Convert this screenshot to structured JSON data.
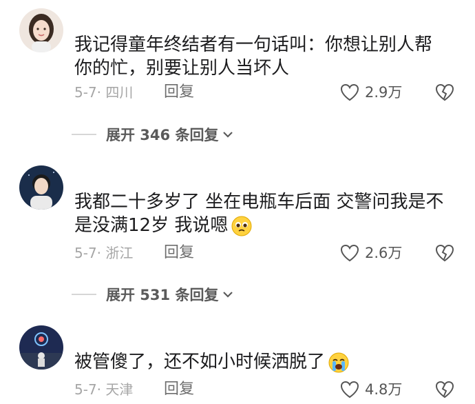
{
  "comments": [
    {
      "text": "我记得童年终结者有一句话叫：你想让别人帮你的忙，别要让别人当坏人",
      "date_location": "5-7· 四川",
      "reply_label": "回复",
      "likes": "2.9万",
      "expand_label": "展开 346 条回复",
      "avatar": "woman-portrait-avatar"
    },
    {
      "text": "我都二十多岁了 坐在电瓶车后面 交警问我是不是没满12岁 我说嗯",
      "emoji": "pleading-face-emoji",
      "date_location": "5-7· 浙江",
      "reply_label": "回复",
      "likes": "2.6万",
      "expand_label": "展开 531 条回复",
      "avatar": "man-portrait-avatar"
    },
    {
      "text": "被管傻了，还不如小时候洒脱了",
      "emoji": "crying-face-emoji",
      "date_location": "5-7· 天津",
      "reply_label": "回复",
      "likes": "4.8万",
      "avatar": "night-sky-avatar"
    }
  ],
  "icons": {
    "like": "heart-outline-icon",
    "dislike": "broken-heart-icon",
    "expand": "chevron-down-icon"
  },
  "colors": {
    "text": "#1c1c1e",
    "meta": "#a6a6a6",
    "secondary": "#5a5a5a"
  }
}
